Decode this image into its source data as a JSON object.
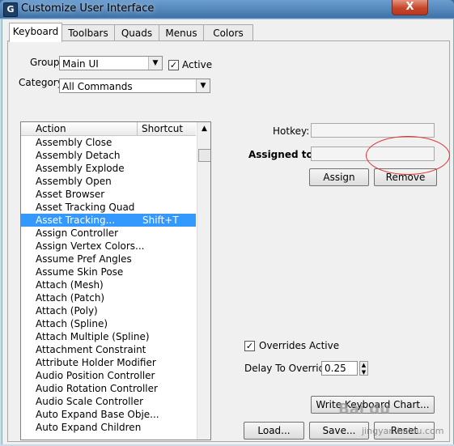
{
  "window": {
    "title": "Customize User Interface",
    "close_glyph": "X",
    "app_icon": "3ds-max-logo-icon",
    "app_icon_glyph": "G"
  },
  "tabs": [
    {
      "label": "Keyboard",
      "active": true
    },
    {
      "label": "Toolbars",
      "active": false
    },
    {
      "label": "Quads",
      "active": false
    },
    {
      "label": "Menus",
      "active": false
    },
    {
      "label": "Colors",
      "active": false
    }
  ],
  "group": {
    "label": "Group:",
    "value": "Main UI"
  },
  "active": {
    "label": "Active",
    "checked": true
  },
  "category": {
    "label": "Category:",
    "value": "All Commands"
  },
  "list": {
    "headers": {
      "action": "Action",
      "shortcut": "Shortcut"
    },
    "rows": [
      {
        "action": "Assembly Close",
        "shortcut": ""
      },
      {
        "action": "Assembly Detach",
        "shortcut": ""
      },
      {
        "action": "Assembly Explode",
        "shortcut": ""
      },
      {
        "action": "Assembly Open",
        "shortcut": ""
      },
      {
        "action": "Asset Browser",
        "shortcut": ""
      },
      {
        "action": "Asset Tracking Quad",
        "shortcut": ""
      },
      {
        "action": "Asset Tracking...",
        "shortcut": "Shift+T",
        "selected": true
      },
      {
        "action": "Assign Controller",
        "shortcut": ""
      },
      {
        "action": "Assign Vertex Colors...",
        "shortcut": ""
      },
      {
        "action": "Assume Pref Angles",
        "shortcut": ""
      },
      {
        "action": "Assume Skin Pose",
        "shortcut": ""
      },
      {
        "action": "Attach (Mesh)",
        "shortcut": ""
      },
      {
        "action": "Attach (Patch)",
        "shortcut": ""
      },
      {
        "action": "Attach (Poly)",
        "shortcut": ""
      },
      {
        "action": "Attach (Spline)",
        "shortcut": ""
      },
      {
        "action": "Attach Multiple (Spline)",
        "shortcut": ""
      },
      {
        "action": "Attachment Constraint",
        "shortcut": ""
      },
      {
        "action": "Attribute Holder Modifier",
        "shortcut": ""
      },
      {
        "action": "Audio Position Controller",
        "shortcut": ""
      },
      {
        "action": "Audio Rotation Controller",
        "shortcut": ""
      },
      {
        "action": "Audio Scale Controller",
        "shortcut": ""
      },
      {
        "action": "Auto Expand Base Obje...",
        "shortcut": ""
      },
      {
        "action": "Auto Expand Children",
        "shortcut": ""
      }
    ]
  },
  "hotkey": {
    "label": "Hotkey:",
    "value": ""
  },
  "assigned_to": {
    "label": "Assigned to:",
    "value": ""
  },
  "buttons": {
    "assign": "Assign",
    "remove": "Remove",
    "write_chart": "Write Keyboard Chart...",
    "load": "Load...",
    "save": "Save...",
    "reset": "Reset"
  },
  "overrides": {
    "label": "Overrides Active",
    "checked": true
  },
  "delay": {
    "label": "Delay To Override:",
    "value": "0.25"
  },
  "watermark": {
    "text": "Bai du",
    "url": "jingyan.baidu.com"
  }
}
